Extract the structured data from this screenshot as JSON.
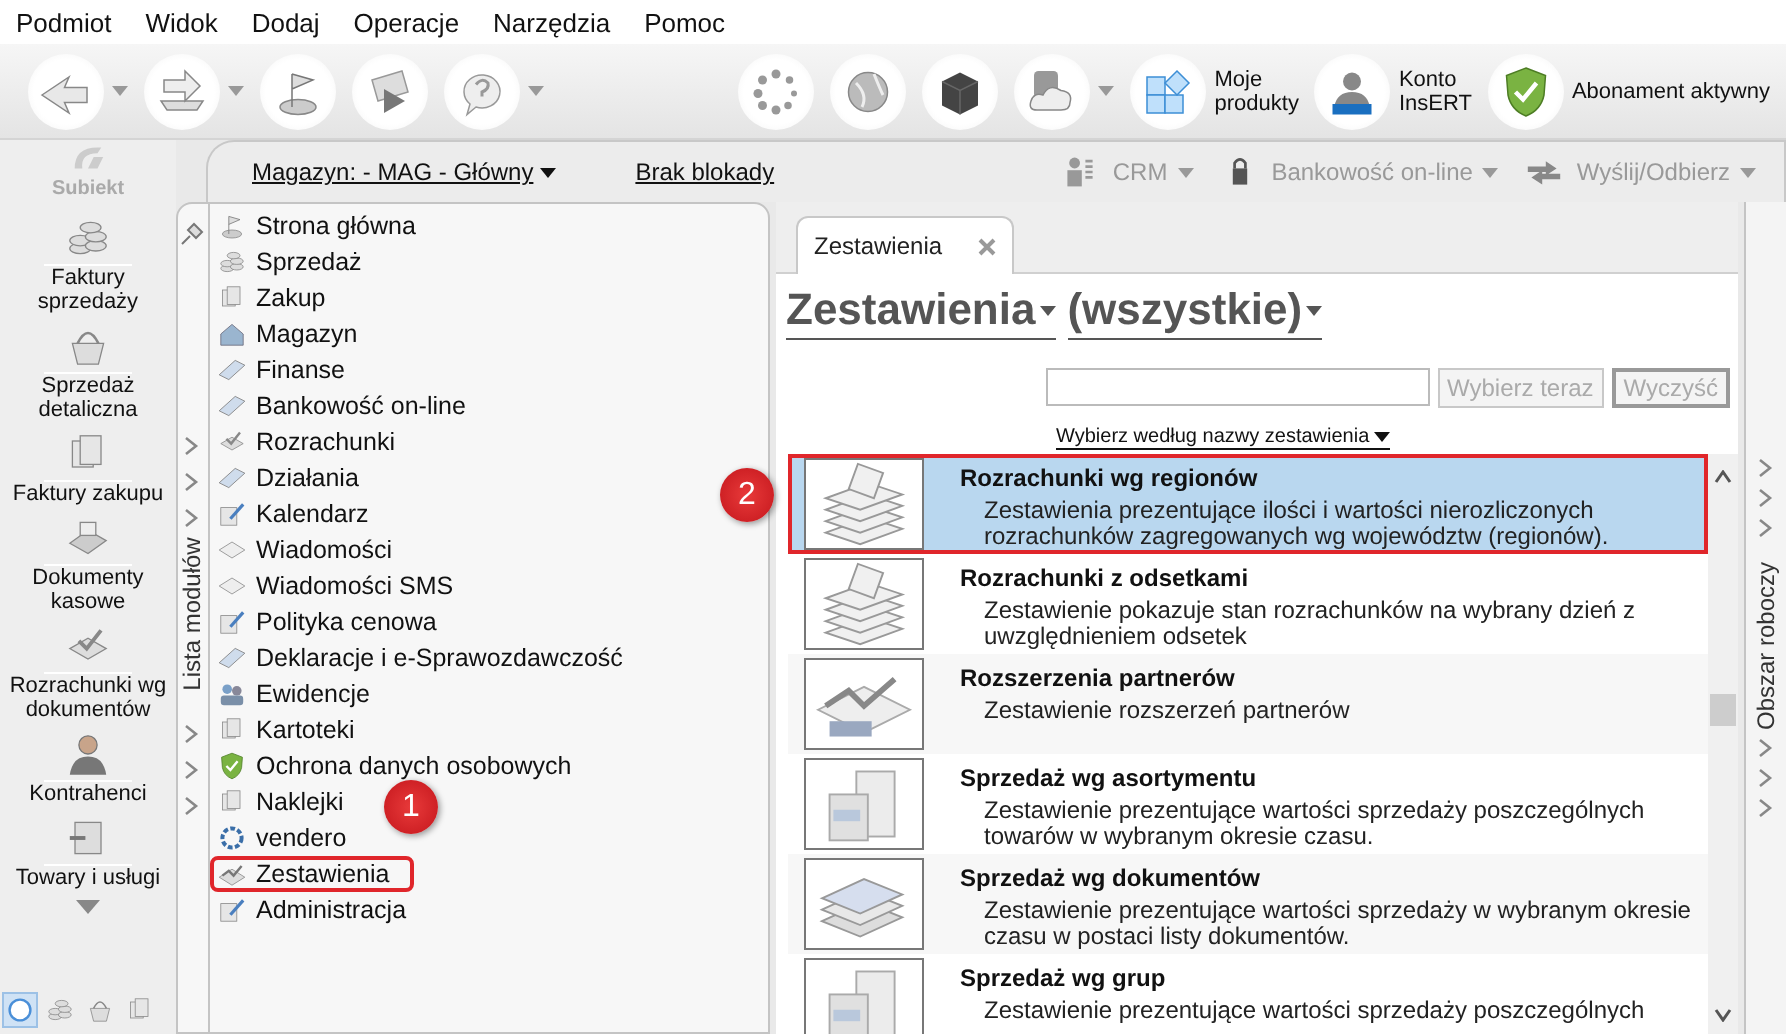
{
  "menu": [
    "Podmiot",
    "Widok",
    "Dodaj",
    "Operacje",
    "Narzędzia",
    "Pomoc"
  ],
  "toolbar": {
    "tools": [
      {
        "kind": "arrow",
        "dropdown": true
      },
      {
        "kind": "tray",
        "dropdown": true
      },
      {
        "kind": "flag",
        "dropdown": false
      },
      {
        "kind": "play",
        "dropdown": false
      },
      {
        "kind": "help",
        "dropdown": true
      },
      {
        "kind": "spinner",
        "dropdown": false
      },
      {
        "kind": "globe",
        "dropdown": false
      },
      {
        "kind": "cube",
        "dropdown": false
      },
      {
        "kind": "cloud",
        "dropdown": true
      },
      {
        "kind": "tiles",
        "dropdown": false,
        "label_lines": [
          "Moje",
          "produkty"
        ]
      },
      {
        "kind": "account",
        "dropdown": false,
        "label_lines": [
          "Konto",
          "InsERT"
        ]
      },
      {
        "kind": "shield",
        "dropdown": false,
        "label_lines": [
          "Abonament aktywny"
        ]
      }
    ]
  },
  "app_logo": "Subiekt",
  "sidebar": {
    "items": [
      {
        "kind": "coins",
        "label": "Faktury sprzedaży"
      },
      {
        "kind": "basket",
        "label": "Sprzedaż detaliczna"
      },
      {
        "kind": "docs",
        "label": "Faktury zakupu"
      },
      {
        "kind": "register",
        "label": "Dokumenty kasowe"
      },
      {
        "kind": "check",
        "label": "Rozrachunki wg dokumentów"
      },
      {
        "kind": "person",
        "label": "Kontrahenci"
      },
      {
        "kind": "box",
        "label": "Towary i usługi"
      }
    ],
    "bottom_icons": [
      {
        "kind": "circle",
        "selected": true
      },
      {
        "kind": "coins",
        "selected": false
      },
      {
        "kind": "basket",
        "selected": false
      },
      {
        "kind": "docs",
        "selected": false
      }
    ]
  },
  "header": {
    "warehouse": "Magazyn: - MAG - Główny",
    "lock": "Brak blokady",
    "actions": [
      {
        "kind": "crm",
        "label": "CRM",
        "disabled": true
      },
      {
        "kind": "bank",
        "label": "Bankowość on-line",
        "disabled": true
      },
      {
        "kind": "send",
        "label": "Wyślij/Odbierz",
        "disabled": true
      }
    ]
  },
  "modules": {
    "tab_label": "Lista modułów",
    "items": [
      {
        "kind": "flag",
        "label": "Strona główna",
        "expandable": false,
        "highlighted": false
      },
      {
        "kind": "coins",
        "label": "Sprzedaż",
        "expandable": false,
        "highlighted": false
      },
      {
        "kind": "docs",
        "label": "Zakup",
        "expandable": false,
        "highlighted": false
      },
      {
        "kind": "house",
        "label": "Magazyn",
        "expandable": false,
        "highlighted": false
      },
      {
        "kind": "card",
        "label": "Finanse",
        "expandable": false,
        "highlighted": false
      },
      {
        "kind": "card",
        "label": "Bankowość on-line",
        "expandable": false,
        "highlighted": false
      },
      {
        "kind": "check",
        "label": "Rozrachunki",
        "expandable": true,
        "highlighted": false
      },
      {
        "kind": "card",
        "label": "Działania",
        "expandable": true,
        "highlighted": false
      },
      {
        "kind": "pen",
        "label": "Kalendarz",
        "expandable": true,
        "highlighted": false
      },
      {
        "kind": "mail",
        "label": "Wiadomości",
        "expandable": false,
        "highlighted": false
      },
      {
        "kind": "mail",
        "label": "Wiadomości SMS",
        "expandable": false,
        "highlighted": false
      },
      {
        "kind": "pen",
        "label": "Polityka cenowa",
        "expandable": false,
        "highlighted": false
      },
      {
        "kind": "card",
        "label": "Deklaracje i e-Sprawozdawczość",
        "expandable": false,
        "highlighted": false
      },
      {
        "kind": "people",
        "label": "Ewidencje",
        "expandable": false,
        "highlighted": false
      },
      {
        "kind": "docs",
        "label": "Kartoteki",
        "expandable": true,
        "highlighted": false
      },
      {
        "kind": "shield",
        "label": "Ochrona danych osobowych",
        "expandable": true,
        "highlighted": false
      },
      {
        "kind": "docs",
        "label": "Naklejki",
        "expandable": true,
        "highlighted": false
      },
      {
        "kind": "gear",
        "label": "vendero",
        "expandable": false,
        "highlighted": false
      },
      {
        "kind": "chart",
        "label": "Zestawienia",
        "expandable": false,
        "highlighted": true
      },
      {
        "kind": "pen",
        "label": "Administracja",
        "expandable": false,
        "highlighted": false
      }
    ]
  },
  "main": {
    "tab": {
      "label": "Zestawienia"
    },
    "title": "Zestawienia",
    "filter": "(wszystkie)",
    "buttons": [
      {
        "label": "Wybierz teraz",
        "disabled": true
      },
      {
        "label": "Wyczyść",
        "disabled": true
      }
    ],
    "sort_link": "Wybierz według nazwy zestawienia",
    "reports": [
      {
        "kind": "money",
        "title": "Rozrachunki wg regionów",
        "description": "Zestawienia prezentujące ilości i wartości nierozliczonych rozrachunków zagregowanych wg województw (regionów).",
        "selected": true,
        "highlighted": true
      },
      {
        "kind": "money",
        "title": "Rozrachunki z odsetkami",
        "description": "Zestawienie pokazuje stan rozrachunków na wybrany dzień z uwzględnieniem odsetek",
        "selected": false,
        "highlighted": false
      },
      {
        "kind": "sql",
        "title": "Rozszerzenia partnerów",
        "description": "Zestawienie rozszerzeń partnerów",
        "selected": false,
        "highlighted": false
      },
      {
        "kind": "boxes",
        "title": "Sprzedaż wg asortymentu",
        "description": "Zestawienie prezentujące wartości sprzedaży poszczególnych towarów w wybranym okresie czasu.",
        "selected": false,
        "highlighted": false
      },
      {
        "kind": "sheets",
        "title": "Sprzedaż wg dokumentów",
        "description": "Zestawienie prezentujące wartości sprzedaży w wybranym okresie czasu w postaci listy dokumentów.",
        "selected": false,
        "highlighted": false
      },
      {
        "kind": "boxes",
        "title": "Sprzedaż wg grup",
        "description": "Zestawienie prezentujące wartości sprzedaży poszczególnych",
        "selected": false,
        "highlighted": false
      }
    ]
  },
  "right_panel": {
    "label": "Obszar roboczy"
  },
  "callouts": [
    {
      "label": "1"
    },
    {
      "label": "2"
    }
  ]
}
